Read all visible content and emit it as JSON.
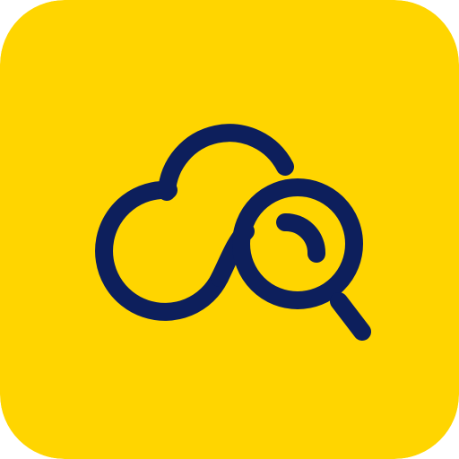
{
  "icon": {
    "name": "cloud-search-icon",
    "description_kind": "app-icon",
    "colors": {
      "background": "#FFD500",
      "glyph": "#0D1F5C"
    }
  }
}
